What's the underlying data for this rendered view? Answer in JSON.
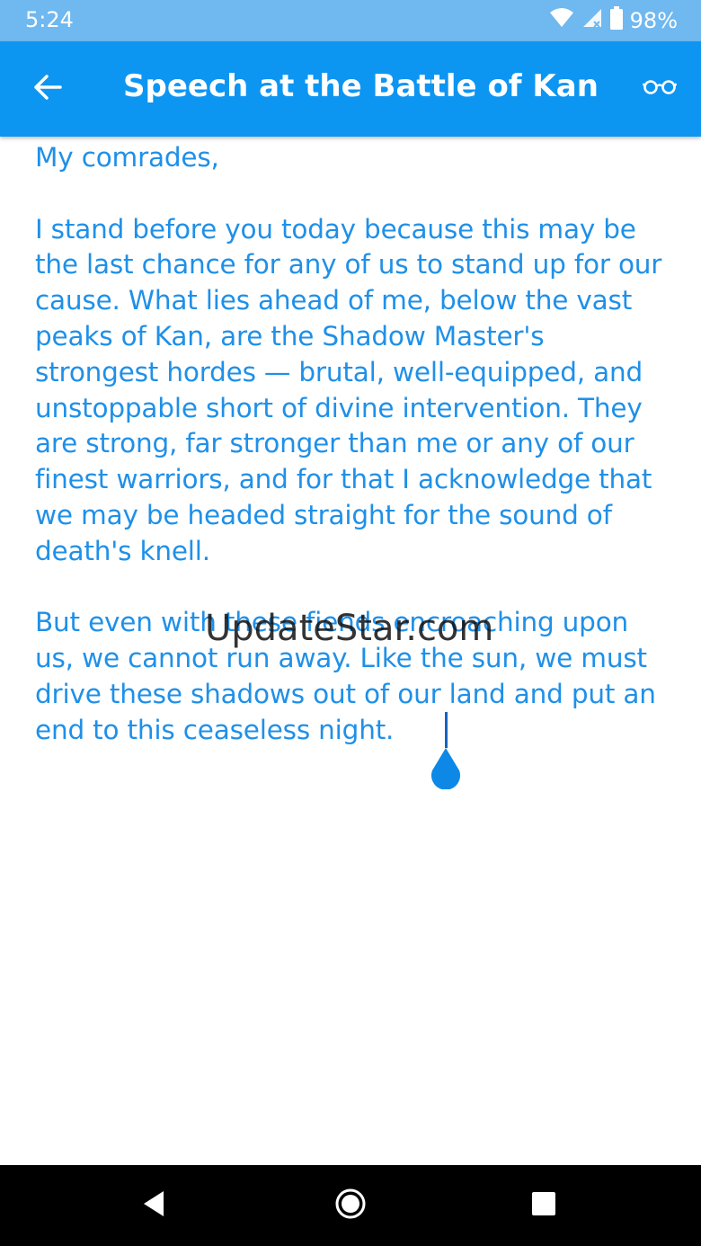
{
  "status_bar": {
    "time": "5:24",
    "battery": "98%",
    "icons": [
      "wifi-icon",
      "cell-signal-icon",
      "battery-icon"
    ]
  },
  "app_bar": {
    "title": "Speech at the Battle of Kan",
    "back_icon": "arrow-left-icon",
    "action_icon": "glasses-icon"
  },
  "document": {
    "paragraphs": [
      "My comrades,",
      "I stand before you today because this may be the last chance for any of us to stand up for our cause. What lies ahead of me, below the vast peaks of Kan, are the Shadow Master's strongest hordes — brutal, well-equipped, and unstoppable short of divine intervention. They are strong, far stronger than me or any of our finest warriors, and for that I acknowledge that we may be headed straight for the sound of death's knell.",
      "But even with these fiends encroaching upon us, we cannot run away. Like the sun, we must drive these shadows out of our land and put an end to this ceaseless night."
    ]
  },
  "watermark": "UpdateStar.com",
  "colors": {
    "status_bar": "#6fb8f0",
    "app_bar": "#0d95f2",
    "text": "#1f90e8",
    "nav_bar": "#000000"
  },
  "nav_bar": {
    "icons": [
      "back-triangle-icon",
      "home-circle-icon",
      "recents-square-icon"
    ]
  }
}
